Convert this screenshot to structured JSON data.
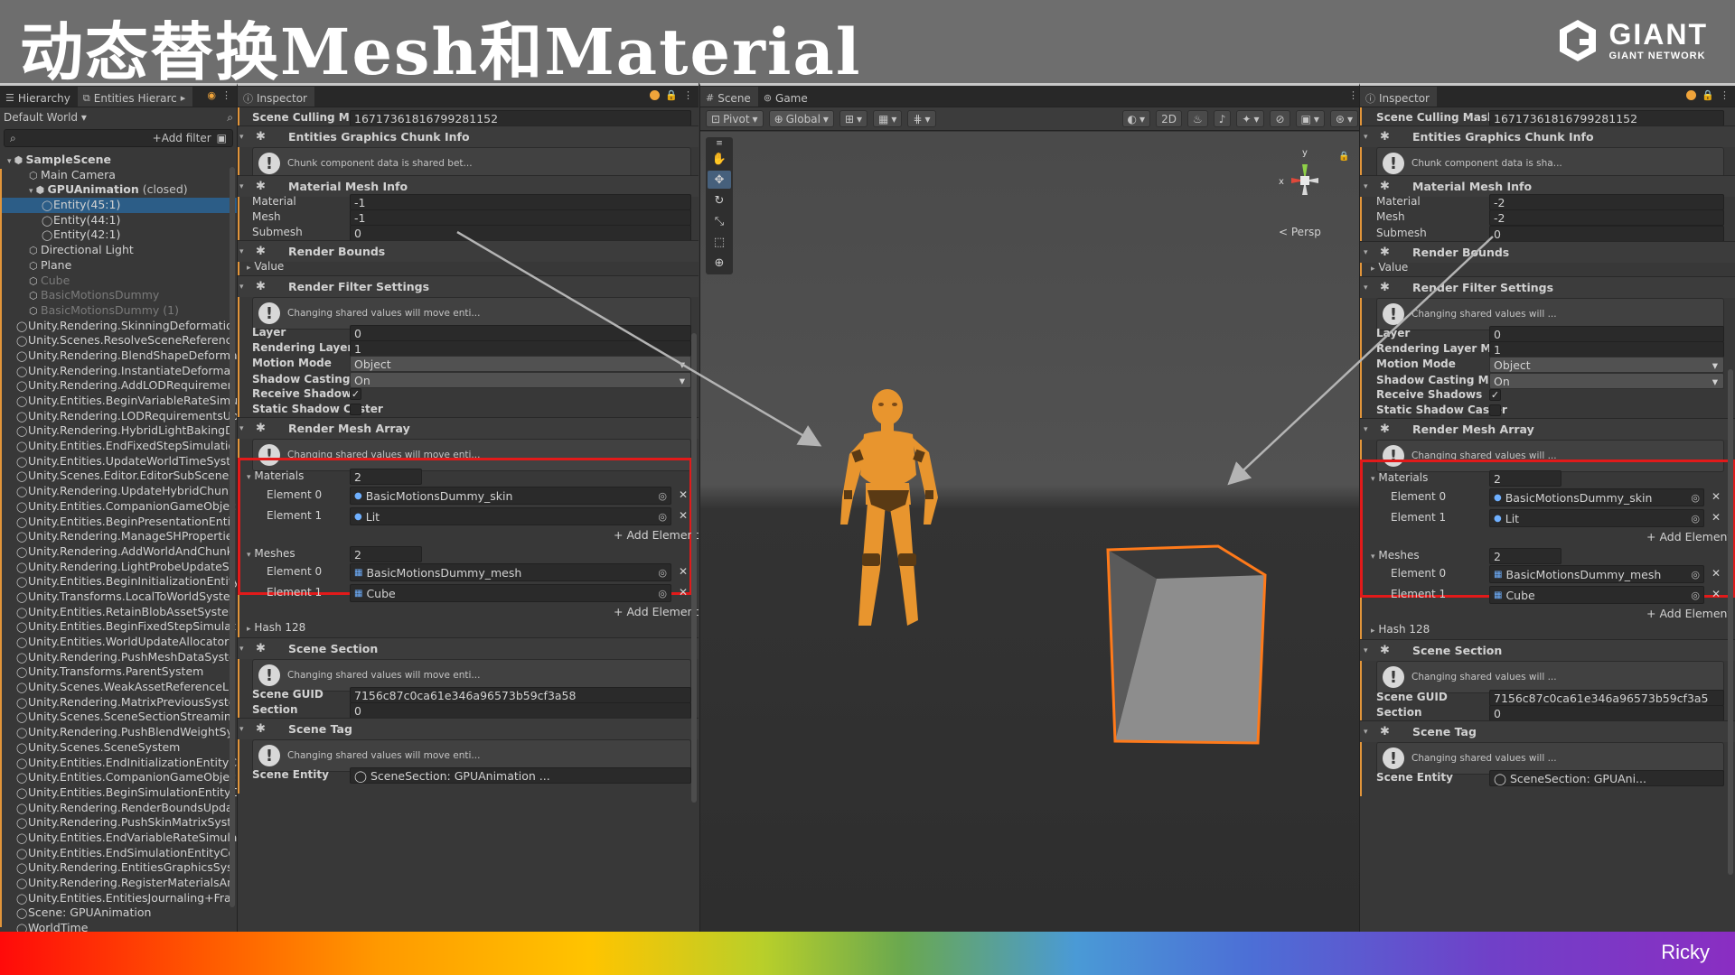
{
  "slide": {
    "title": "动态替换Mesh和Material",
    "logo_main": "GIANT",
    "logo_sub": "GIANT NETWORK",
    "author": "Ricky"
  },
  "hierarchy": {
    "tabs": [
      "Hierarchy",
      "Entities Hierarc"
    ],
    "world_selector": "Default World",
    "add_filter": "+Add filter",
    "items": [
      {
        "label": "SampleScene",
        "indent": 0,
        "icon": "unity-icon",
        "style": "bold"
      },
      {
        "label": "Main Camera",
        "indent": 1,
        "icon": "cube-icon",
        "style": ""
      },
      {
        "label": "GPUAnimation",
        "suffix": "(closed)",
        "indent": 1,
        "icon": "unity-icon",
        "style": "bold"
      },
      {
        "label": "Entity(45:1)",
        "indent": 2,
        "icon": "entity-icon",
        "style": "selected"
      },
      {
        "label": "Entity(44:1)",
        "indent": 2,
        "icon": "entity-icon",
        "style": ""
      },
      {
        "label": "Entity(42:1)",
        "indent": 2,
        "icon": "entity-icon",
        "style": ""
      },
      {
        "label": "Directional Light",
        "indent": 1,
        "icon": "cube-icon",
        "style": ""
      },
      {
        "label": "Plane",
        "indent": 1,
        "icon": "cube-icon",
        "style": ""
      },
      {
        "label": "Cube",
        "indent": 1,
        "icon": "cube-icon",
        "style": "dim"
      },
      {
        "label": "BasicMotionsDummy",
        "indent": 1,
        "icon": "cube-icon",
        "style": "dim"
      },
      {
        "label": "BasicMotionsDummy (1)",
        "indent": 1,
        "icon": "cube-icon",
        "style": "dim"
      },
      {
        "label": "Unity.Rendering.SkinningDeformatio",
        "indent": 0,
        "icon": "entity-icon",
        "style": ""
      },
      {
        "label": "Unity.Scenes.ResolveSceneReferenc",
        "indent": 0,
        "icon": "entity-icon",
        "style": ""
      },
      {
        "label": "Unity.Rendering.BlendShapeDeforma",
        "indent": 0,
        "icon": "entity-icon",
        "style": ""
      },
      {
        "label": "Unity.Rendering.InstantiateDeformat",
        "indent": 0,
        "icon": "entity-icon",
        "style": ""
      },
      {
        "label": "Unity.Rendering.AddLODRequiremen",
        "indent": 0,
        "icon": "entity-icon",
        "style": ""
      },
      {
        "label": "Unity.Entities.BeginVariableRateSimu",
        "indent": 0,
        "icon": "entity-icon",
        "style": ""
      },
      {
        "label": "Unity.Rendering.LODRequirementsUp",
        "indent": 0,
        "icon": "entity-icon",
        "style": ""
      },
      {
        "label": "Unity.Rendering.HybridLightBakingD",
        "indent": 0,
        "icon": "entity-icon",
        "style": ""
      },
      {
        "label": "Unity.Entities.EndFixedStepSimulatio",
        "indent": 0,
        "icon": "entity-icon",
        "style": ""
      },
      {
        "label": "Unity.Entities.UpdateWorldTimeSyst",
        "indent": 0,
        "icon": "entity-icon",
        "style": ""
      },
      {
        "label": "Unity.Scenes.Editor.EditorSubScenel",
        "indent": 0,
        "icon": "entity-icon",
        "style": ""
      },
      {
        "label": "Unity.Rendering.UpdateHybridChunk",
        "indent": 0,
        "icon": "entity-icon",
        "style": ""
      },
      {
        "label": "Unity.Entities.CompanionGameObjec",
        "indent": 0,
        "icon": "entity-icon",
        "style": ""
      },
      {
        "label": "Unity.Entities.BeginPresentationEntit",
        "indent": 0,
        "icon": "entity-icon",
        "style": ""
      },
      {
        "label": "Unity.Rendering.ManageSHPropertie",
        "indent": 0,
        "icon": "entity-icon",
        "style": ""
      },
      {
        "label": "Unity.Rendering.AddWorldAndChunk",
        "indent": 0,
        "icon": "entity-icon",
        "style": ""
      },
      {
        "label": "Unity.Rendering.LightProbeUpdateS",
        "indent": 0,
        "icon": "entity-icon",
        "style": ""
      },
      {
        "label": "Unity.Entities.BeginInitializationEntity",
        "indent": 0,
        "icon": "entity-icon",
        "style": ""
      },
      {
        "label": "Unity.Transforms.LocalToWorldSyste",
        "indent": 0,
        "icon": "entity-icon",
        "style": ""
      },
      {
        "label": "Unity.Entities.RetainBlobAssetSyster",
        "indent": 0,
        "icon": "entity-icon",
        "style": ""
      },
      {
        "label": "Unity.Entities.BeginFixedStepSimulat",
        "indent": 0,
        "icon": "entity-icon",
        "style": ""
      },
      {
        "label": "Unity.Entities.WorldUpdateAllocatorF",
        "indent": 0,
        "icon": "entity-icon",
        "style": ""
      },
      {
        "label": "Unity.Rendering.PushMeshDataSyste",
        "indent": 0,
        "icon": "entity-icon",
        "style": ""
      },
      {
        "label": "Unity.Transforms.ParentSystem",
        "indent": 0,
        "icon": "entity-icon",
        "style": ""
      },
      {
        "label": "Unity.Scenes.WeakAssetReferenceL",
        "indent": 0,
        "icon": "entity-icon",
        "style": ""
      },
      {
        "label": "Unity.Rendering.MatrixPreviousSyste",
        "indent": 0,
        "icon": "entity-icon",
        "style": ""
      },
      {
        "label": "Unity.Scenes.SceneSectionStreamin",
        "indent": 0,
        "icon": "entity-icon",
        "style": ""
      },
      {
        "label": "Unity.Rendering.PushBlendWeightSy",
        "indent": 0,
        "icon": "entity-icon",
        "style": ""
      },
      {
        "label": "Unity.Scenes.SceneSystem",
        "indent": 0,
        "icon": "entity-icon",
        "style": ""
      },
      {
        "label": "Unity.Entities.EndInitializationEntityC",
        "indent": 0,
        "icon": "entity-icon",
        "style": ""
      },
      {
        "label": "Unity.Entities.CompanionGameObjec",
        "indent": 0,
        "icon": "entity-icon",
        "style": ""
      },
      {
        "label": "Unity.Entities.BeginSimulationEntityC",
        "indent": 0,
        "icon": "entity-icon",
        "style": ""
      },
      {
        "label": "Unity.Rendering.RenderBoundsUpda",
        "indent": 0,
        "icon": "entity-icon",
        "style": ""
      },
      {
        "label": "Unity.Rendering.PushSkinMatrixSyst",
        "indent": 0,
        "icon": "entity-icon",
        "style": ""
      },
      {
        "label": "Unity.Entities.EndVariableRateSimula",
        "indent": 0,
        "icon": "entity-icon",
        "style": ""
      },
      {
        "label": "Unity.Entities.EndSimulationEntityCo",
        "indent": 0,
        "icon": "entity-icon",
        "style": ""
      },
      {
        "label": "Unity.Rendering.EntitiesGraphicsSys",
        "indent": 0,
        "icon": "entity-icon",
        "style": ""
      },
      {
        "label": "Unity.Rendering.RegisterMaterialsAn",
        "indent": 0,
        "icon": "entity-icon",
        "style": ""
      },
      {
        "label": "Unity.Entities.EntitiesJournaling+Frai",
        "indent": 0,
        "icon": "entity-icon",
        "style": ""
      },
      {
        "label": "Scene: GPUAnimation",
        "indent": 0,
        "icon": "entity-icon",
        "style": ""
      },
      {
        "label": "WorldTime",
        "indent": 0,
        "icon": "entity-icon",
        "style": ""
      }
    ]
  },
  "inspector_left": {
    "tab": "Inspector",
    "scene_culling_mask_label": "Scene Culling Mask",
    "scene_culling_mask": "16717361816799281152",
    "chunk_info_title": "Entities Graphics Chunk Info",
    "chunk_info_help": "Chunk component data is shared bet...",
    "material_mesh_info_title": "Material Mesh Info",
    "material_label": "Material",
    "material_value": "-1",
    "mesh_label": "Mesh",
    "mesh_value": "-1",
    "submesh_label": "Submesh",
    "submesh_value": "0",
    "render_bounds_title": "Render Bounds",
    "value_label": "Value",
    "filter_title": "Render Filter Settings",
    "filter_help": "Changing shared values will move enti...",
    "layer_label": "Layer",
    "layer_value": "0",
    "rlm_label": "Rendering Layer Mask",
    "rlm_value": "1",
    "motion_mode_label": "Motion Mode",
    "motion_mode_value": "Object",
    "shadow_mode_label": "Shadow Casting Mode",
    "shadow_mode_value": "On",
    "receive_shadows_label": "Receive Shadows",
    "static_caster_label": "Static Shadow Caster",
    "rma_title": "Render Mesh Array",
    "rma_help": "Changing shared values will move enti...",
    "materials_label": "Materials",
    "materials_count": "2",
    "mat_el0_label": "Element 0",
    "mat_el0_value": "BasicMotionsDummy_skin",
    "mat_el1_label": "Element 1",
    "mat_el1_value": "Lit",
    "add_element": "+ Add Element",
    "meshes_label": "Meshes",
    "meshes_count": "2",
    "mesh_el0_label": "Element 0",
    "mesh_el0_value": "BasicMotionsDummy_mesh",
    "mesh_el1_label": "Element 1",
    "mesh_el1_value": "Cube",
    "hash_label": "Hash 128",
    "scene_section_title": "Scene Section",
    "scene_section_help": "Changing shared values will move enti...",
    "guid_label": "Scene GUID",
    "guid_value": "7156c87c0ca61e346a96573b59cf3a58",
    "section_label": "Section",
    "section_value": "0",
    "scene_tag_title": "Scene Tag",
    "scene_tag_help": "Changing shared values will move enti...",
    "scene_entity_label": "Scene Entity",
    "scene_entity_value": "SceneSection: GPUAnimation ..."
  },
  "inspector_right": {
    "tab": "Inspector",
    "scene_culling_mask_label": "Scene Culling Mask",
    "scene_culling_mask": "16717361816799281152",
    "chunk_info_title": "Entities Graphics Chunk Info",
    "chunk_info_help": "Chunk component data is sha...",
    "material_mesh_info_title": "Material Mesh Info",
    "material_label": "Material",
    "material_value": "-2",
    "mesh_label": "Mesh",
    "mesh_value": "-2",
    "submesh_label": "Submesh",
    "submesh_value": "0",
    "render_bounds_title": "Render Bounds",
    "value_label": "Value",
    "filter_title": "Render Filter Settings",
    "filter_help": "Changing shared values will ...",
    "layer_label": "Layer",
    "layer_value": "0",
    "rlm_label": "Rendering Layer Mask",
    "rlm_value": "1",
    "motion_mode_label": "Motion Mode",
    "motion_mode_value": "Object",
    "shadow_mode_label": "Shadow Casting Mode",
    "shadow_mode_value": "On",
    "receive_shadows_label": "Receive Shadows",
    "static_caster_label": "Static Shadow Caster",
    "rma_title": "Render Mesh Array",
    "rma_help": "Changing shared values will ...",
    "materials_label": "Materials",
    "materials_count": "2",
    "mat_el0_label": "Element 0",
    "mat_el0_value": "BasicMotionsDummy_skin",
    "mat_el1_label": "Element 1",
    "mat_el1_value": "Lit",
    "add_element": "+ Add Element",
    "meshes_label": "Meshes",
    "meshes_count": "2",
    "mesh_el0_label": "Element 0",
    "mesh_el0_value": "BasicMotionsDummy_mesh",
    "mesh_el1_label": "Element 1",
    "mesh_el1_value": "Cube",
    "hash_label": "Hash 128",
    "scene_section_title": "Scene Section",
    "scene_section_help": "Changing shared values will ...",
    "guid_label": "Scene GUID",
    "guid_value": "7156c87c0ca61e346a96573b59cf3a5",
    "section_label": "Section",
    "section_value": "0",
    "scene_tag_title": "Scene Tag",
    "scene_tag_help": "Changing shared values will ...",
    "scene_entity_label": "Scene Entity",
    "scene_entity_value": "SceneSection: GPUAni..."
  },
  "scene": {
    "tabs": [
      "Scene",
      "Game"
    ],
    "pivot": "Pivot",
    "global": "Global",
    "mode_2d": "2D",
    "persp": "Persp",
    "character_color": "#e8952e",
    "cube_outline_color": "#ff7a1a"
  },
  "colors": {
    "selection": "#2c5d87",
    "highlight_box": "#e21a1a",
    "modified_bar": "#e2953a"
  }
}
